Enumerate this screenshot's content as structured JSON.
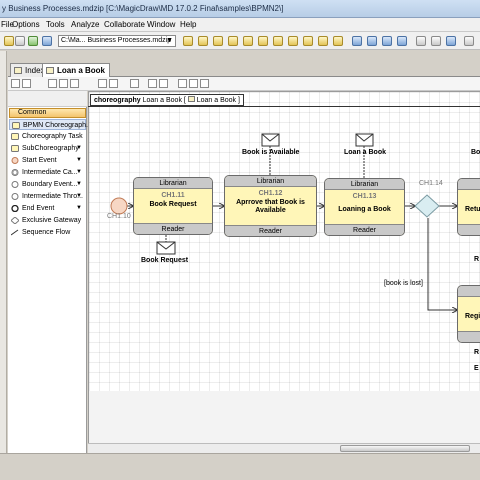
{
  "window": {
    "title": "y Business Processes.mdzip [C:\\MagicDraw\\MD 17.0.2 Final\\samples\\BPMN2\\]"
  },
  "menu": [
    "File",
    "Options",
    "Tools",
    "Analyze",
    "Collaborate",
    "Window",
    "Help"
  ],
  "toolbar": {
    "project_combo": "C:\\Ma... Business Processes.mdzip"
  },
  "tabs": [
    {
      "label": "Index"
    },
    {
      "label": "Loan a Book"
    }
  ],
  "palette": {
    "group": "Common",
    "items": [
      {
        "label": "BPMN Choreograph..."
      },
      {
        "label": "Choreography Task"
      },
      {
        "label": "SubChoreography"
      },
      {
        "label": "Start Event"
      },
      {
        "label": "Intermediate Ca..."
      },
      {
        "label": "Boundary Event..."
      },
      {
        "label": "Intermediate Thro..."
      },
      {
        "label": "End Event"
      },
      {
        "label": "Exclusive Gateway"
      },
      {
        "label": "Sequence Flow"
      }
    ]
  },
  "diagram": {
    "frame_keyword": "choreography",
    "frame_name": "Loan a Book [",
    "frame_link": "Loan a Book",
    "frame_close": "]",
    "start_event": {
      "id": "CH1.10"
    },
    "gateway": {
      "id": "CH1.14"
    },
    "guard": "[book is lost]",
    "tasks": [
      {
        "top": "Librarian",
        "id": "CH1.11",
        "name": "Book Request",
        "bottom": "Reader"
      },
      {
        "top": "Librarian",
        "id": "CH1.12",
        "name": "Aprrove that Book is Available",
        "bottom": "Reader"
      },
      {
        "top": "Librarian",
        "id": "CH1.13",
        "name": "Loaning a Book",
        "bottom": "Reader"
      },
      {
        "top": "",
        "id": "",
        "name": "Retu",
        "bottom": ""
      },
      {
        "top": "",
        "id": "",
        "name": "Regi",
        "bottom": ""
      }
    ],
    "messages": {
      "book_request": "Book Request",
      "book_available": "Book is Available",
      "loan_a_book": "Loan a Book",
      "partial_bo": "Bo"
    },
    "cut_labels": {
      "r1": "R",
      "r2": "R",
      "e": "E"
    }
  }
}
